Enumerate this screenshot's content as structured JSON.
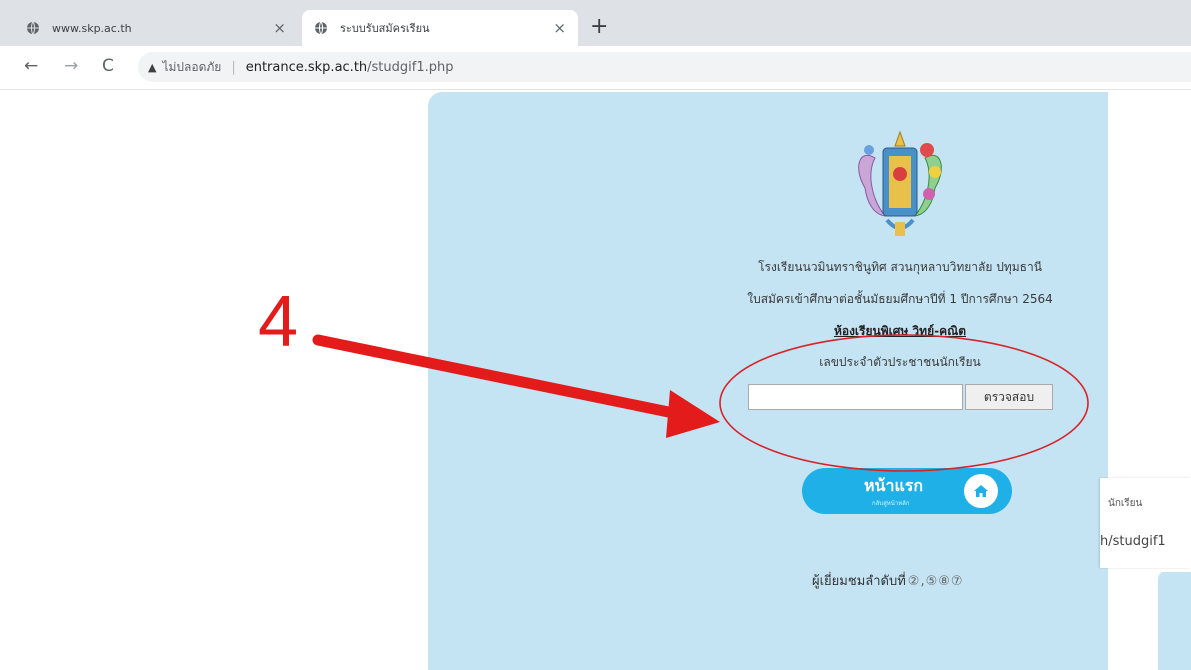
{
  "browser": {
    "tabs": [
      {
        "title": "www.skp.ac.th",
        "active": false
      },
      {
        "title": "ระบบรับสมัครเรียน",
        "active": true
      }
    ],
    "new_tab_symbol": "+",
    "close_symbol": "×",
    "nav": {
      "back": "←",
      "forward": "→",
      "reload": "C"
    },
    "address": {
      "security_icon": "warning-triangle-icon",
      "not_secure_label": "ไม่ปลอดภัย",
      "separator": "|",
      "host": "entrance.skp.ac.th",
      "path": "/studgif1.php"
    }
  },
  "page": {
    "school_name": "โรงเรียนนวมินทราชินูทิศ สวนกุหลาบวิทยาลัย ปทุมธานี",
    "application_title": "ใบสมัครเข้าศึกษาต่อชั้นมัธยมศึกษาปีที่ 1 ปีการศึกษา 2564",
    "program": "ห้องเรียนพิเศษ วิทย์-คณิต",
    "id_label": "เลขประจำตัวประชาชนนักเรียน",
    "id_input_value": "",
    "check_button": "ตรวจสอบ",
    "home_button": {
      "label": "หน้าแรก",
      "sublabel": "กลับสู่หน้าหลัก",
      "icon": "home-icon"
    },
    "visitor_label": "ผู้เยี่ยมชมลำดับที่",
    "visitor_count": "②,⑤⑧⑦"
  },
  "background_window": {
    "tab_title": "นักเรียน",
    "url_fragment": "h/studgif1"
  },
  "annotation": {
    "step_number": "4",
    "color": "#e31b1b"
  },
  "colors": {
    "panel": "#c4e4f4",
    "home_button": "#1eb0e6",
    "annotation": "#e31b1b"
  }
}
